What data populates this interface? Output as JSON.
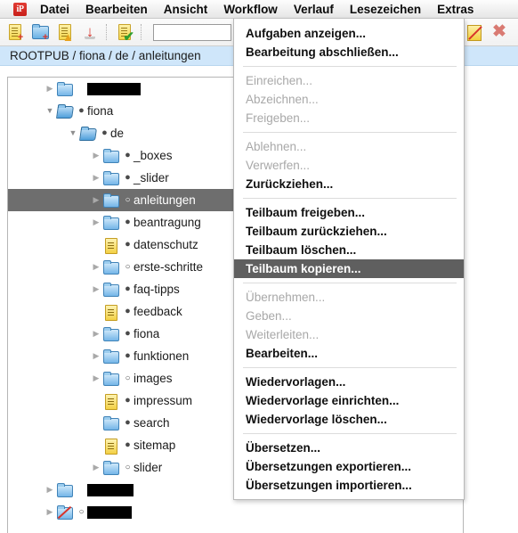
{
  "app": {
    "logo_text": "iP"
  },
  "menubar": {
    "items": [
      {
        "label": "Datei",
        "active": false
      },
      {
        "label": "Bearbeiten",
        "active": false
      },
      {
        "label": "Ansicht",
        "active": false
      },
      {
        "label": "Workflow",
        "active": true
      },
      {
        "label": "Verlauf",
        "active": false
      },
      {
        "label": "Lesezeichen",
        "active": false
      },
      {
        "label": "Extras",
        "active": false
      }
    ]
  },
  "toolbar": {
    "icons": [
      {
        "name": "new-document-icon",
        "glyph": "+"
      },
      {
        "name": "new-folder-icon",
        "glyph": "+"
      },
      {
        "name": "upload-document-icon",
        "glyph": "▲"
      },
      {
        "name": "download-icon",
        "glyph": "↓"
      },
      {
        "name": "approve-document-icon",
        "glyph": "✔"
      },
      {
        "name": "edit-disabled-icon",
        "glyph": ""
      },
      {
        "name": "close-icon",
        "glyph": "✖"
      }
    ],
    "search_value": "",
    "search_placeholder": ""
  },
  "breadcrumb": {
    "text": "ROOTPUB / fiona / de / anleitungen"
  },
  "tree": {
    "rows": [
      {
        "indent": 1,
        "twisty": "closed",
        "icon": "folder",
        "marker": "none",
        "label": "",
        "redacted_width": 60
      },
      {
        "indent": 1,
        "twisty": "open",
        "icon": "folder-open",
        "marker": "filled",
        "label": "fiona",
        "redacted_width": 0
      },
      {
        "indent": 2,
        "twisty": "open",
        "icon": "folder-open",
        "marker": "filled",
        "label": "de",
        "redacted_width": 0
      },
      {
        "indent": 3,
        "twisty": "closed",
        "icon": "folder",
        "marker": "filled",
        "label": "_boxes",
        "redacted_width": 0
      },
      {
        "indent": 3,
        "twisty": "closed",
        "icon": "folder",
        "marker": "filled",
        "label": "_slider",
        "redacted_width": 0
      },
      {
        "indent": 3,
        "twisty": "closed",
        "icon": "folder",
        "marker": "hollow",
        "label": "anleitungen",
        "redacted_width": 0,
        "selected": true
      },
      {
        "indent": 3,
        "twisty": "closed",
        "icon": "folder",
        "marker": "filled",
        "label": "beantragung",
        "redacted_width": 0
      },
      {
        "indent": 3,
        "twisty": "none",
        "icon": "document",
        "marker": "filled",
        "label": "datenschutz",
        "redacted_width": 0
      },
      {
        "indent": 3,
        "twisty": "closed",
        "icon": "folder",
        "marker": "hollow",
        "label": "erste-schritte",
        "redacted_width": 0
      },
      {
        "indent": 3,
        "twisty": "closed",
        "icon": "folder",
        "marker": "filled",
        "label": "faq-tipps",
        "redacted_width": 0
      },
      {
        "indent": 3,
        "twisty": "none",
        "icon": "document",
        "marker": "filled",
        "label": "feedback",
        "redacted_width": 0
      },
      {
        "indent": 3,
        "twisty": "closed",
        "icon": "folder",
        "marker": "filled",
        "label": "fiona",
        "redacted_width": 0
      },
      {
        "indent": 3,
        "twisty": "closed",
        "icon": "folder",
        "marker": "filled",
        "label": "funktionen",
        "redacted_width": 0
      },
      {
        "indent": 3,
        "twisty": "closed",
        "icon": "folder",
        "marker": "hollow",
        "label": "images",
        "redacted_width": 0
      },
      {
        "indent": 3,
        "twisty": "none",
        "icon": "document",
        "marker": "filled",
        "label": "impressum",
        "redacted_width": 0
      },
      {
        "indent": 3,
        "twisty": "none",
        "icon": "folder",
        "marker": "filled",
        "label": "search",
        "redacted_width": 0
      },
      {
        "indent": 3,
        "twisty": "none",
        "icon": "document",
        "marker": "filled",
        "label": "sitemap",
        "redacted_width": 0
      },
      {
        "indent": 3,
        "twisty": "closed",
        "icon": "folder",
        "marker": "hollow",
        "label": "slider",
        "redacted_width": 0
      },
      {
        "indent": 1,
        "twisty": "closed",
        "icon": "folder",
        "marker": "none",
        "label": "",
        "redacted_width": 52
      },
      {
        "indent": 1,
        "twisty": "closed",
        "icon": "folder-slash",
        "marker": "hollow",
        "label": "",
        "redacted_width": 50
      }
    ]
  },
  "dropdown": {
    "title": "Workflow",
    "groups": [
      {
        "items": [
          {
            "label": "Aufgaben anzeigen...",
            "state": "enabled"
          },
          {
            "label": "Bearbeitung abschließen...",
            "state": "enabled"
          }
        ]
      },
      {
        "items": [
          {
            "label": "Einreichen...",
            "state": "disabled"
          },
          {
            "label": "Abzeichnen...",
            "state": "disabled"
          },
          {
            "label": "Freigeben...",
            "state": "disabled"
          }
        ]
      },
      {
        "items": [
          {
            "label": "Ablehnen...",
            "state": "disabled"
          },
          {
            "label": "Verwerfen...",
            "state": "disabled"
          },
          {
            "label": "Zurückziehen...",
            "state": "enabled"
          }
        ]
      },
      {
        "items": [
          {
            "label": "Teilbaum freigeben...",
            "state": "enabled"
          },
          {
            "label": "Teilbaum zurückziehen...",
            "state": "enabled"
          },
          {
            "label": "Teilbaum löschen...",
            "state": "enabled"
          },
          {
            "label": "Teilbaum kopieren...",
            "state": "highlighted"
          }
        ]
      },
      {
        "items": [
          {
            "label": "Übernehmen...",
            "state": "disabled"
          },
          {
            "label": "Geben...",
            "state": "disabled"
          },
          {
            "label": "Weiterleiten...",
            "state": "disabled"
          },
          {
            "label": "Bearbeiten...",
            "state": "enabled"
          }
        ]
      },
      {
        "items": [
          {
            "label": "Wiedervorlagen...",
            "state": "enabled"
          },
          {
            "label": "Wiedervorlage einrichten...",
            "state": "enabled"
          },
          {
            "label": "Wiedervorlage löschen...",
            "state": "enabled"
          }
        ]
      },
      {
        "items": [
          {
            "label": "Übersetzen...",
            "state": "enabled"
          },
          {
            "label": "Übersetzungen exportieren...",
            "state": "enabled"
          },
          {
            "label": "Übersetzungen importieren...",
            "state": "enabled"
          }
        ]
      }
    ]
  },
  "colors": {
    "selection": "#6e6e6e",
    "menu_highlight": "#5f5f5f",
    "breadcrumb_bg": "#cfe6fa",
    "brand": "#c8201a"
  }
}
